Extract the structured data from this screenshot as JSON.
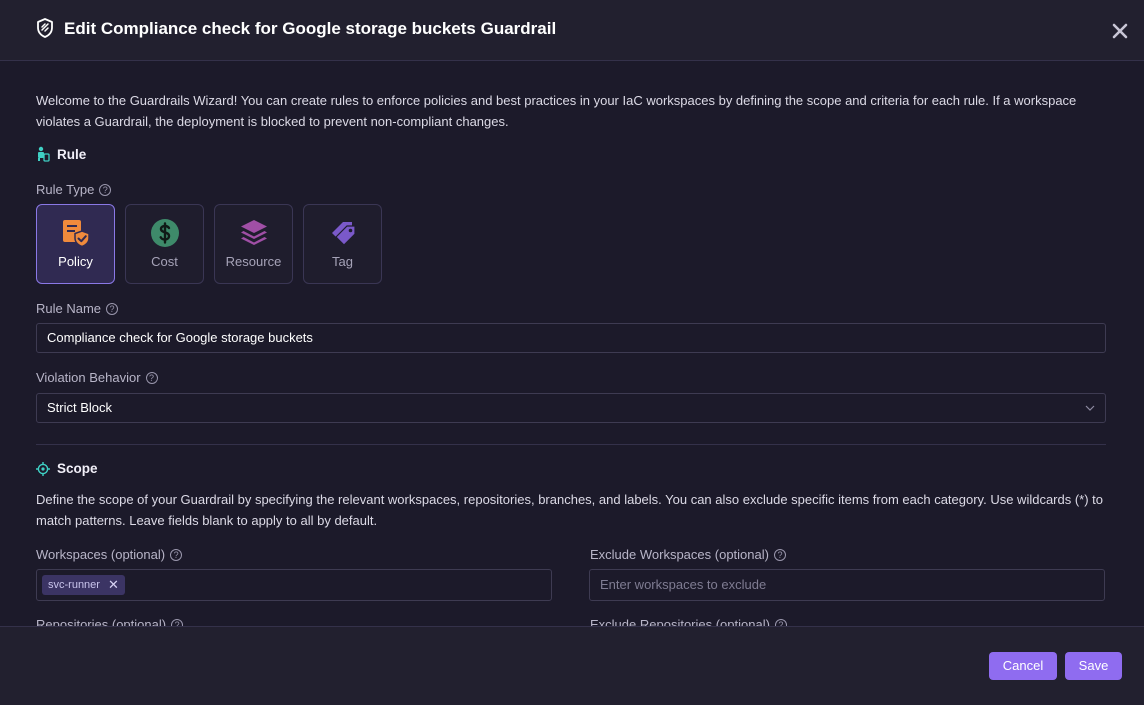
{
  "header": {
    "title": "Edit Compliance check for Google storage buckets Guardrail"
  },
  "intro": "Welcome to the Guardrails Wizard! You can create rules to enforce policies and best practices in your IaC workspaces by defining the scope and criteria for each rule. If a workspace violates a Guardrail, the deployment is blocked to prevent non-compliant changes.",
  "rule": {
    "section_title": "Rule",
    "type_label": "Rule Type",
    "types": [
      {
        "label": "Policy",
        "icon": "policy-icon",
        "selected": true
      },
      {
        "label": "Cost",
        "icon": "dollar-icon",
        "selected": false
      },
      {
        "label": "Resource",
        "icon": "layers-icon",
        "selected": false
      },
      {
        "label": "Tag",
        "icon": "tag-icon",
        "selected": false
      }
    ],
    "name_label": "Rule Name",
    "name_value": "Compliance check for Google storage buckets",
    "violation_label": "Violation Behavior",
    "violation_value": "Strict Block"
  },
  "scope": {
    "section_title": "Scope",
    "description": "Define the scope of your Guardrail by specifying the relevant workspaces, repositories, branches, and labels. You can also exclude specific items from each category. Use wildcards (*) to match patterns. Leave fields blank to apply to all by default.",
    "workspaces_label": "Workspaces (optional)",
    "workspaces_chips": [
      "svc-runner"
    ],
    "exclude_workspaces_label": "Exclude Workspaces (optional)",
    "exclude_workspaces_placeholder": "Enter workspaces to exclude",
    "repositories_label": "Repositories (optional)",
    "exclude_repositories_label": "Exclude Repositories (optional)"
  },
  "footer": {
    "cancel_label": "Cancel",
    "save_label": "Save"
  },
  "colors": {
    "accent": "#8f6cf0",
    "policy": "#f08a3c",
    "cost": "#3e8a6a",
    "resource": "#a04fa6",
    "tag": "#7a59c9"
  }
}
